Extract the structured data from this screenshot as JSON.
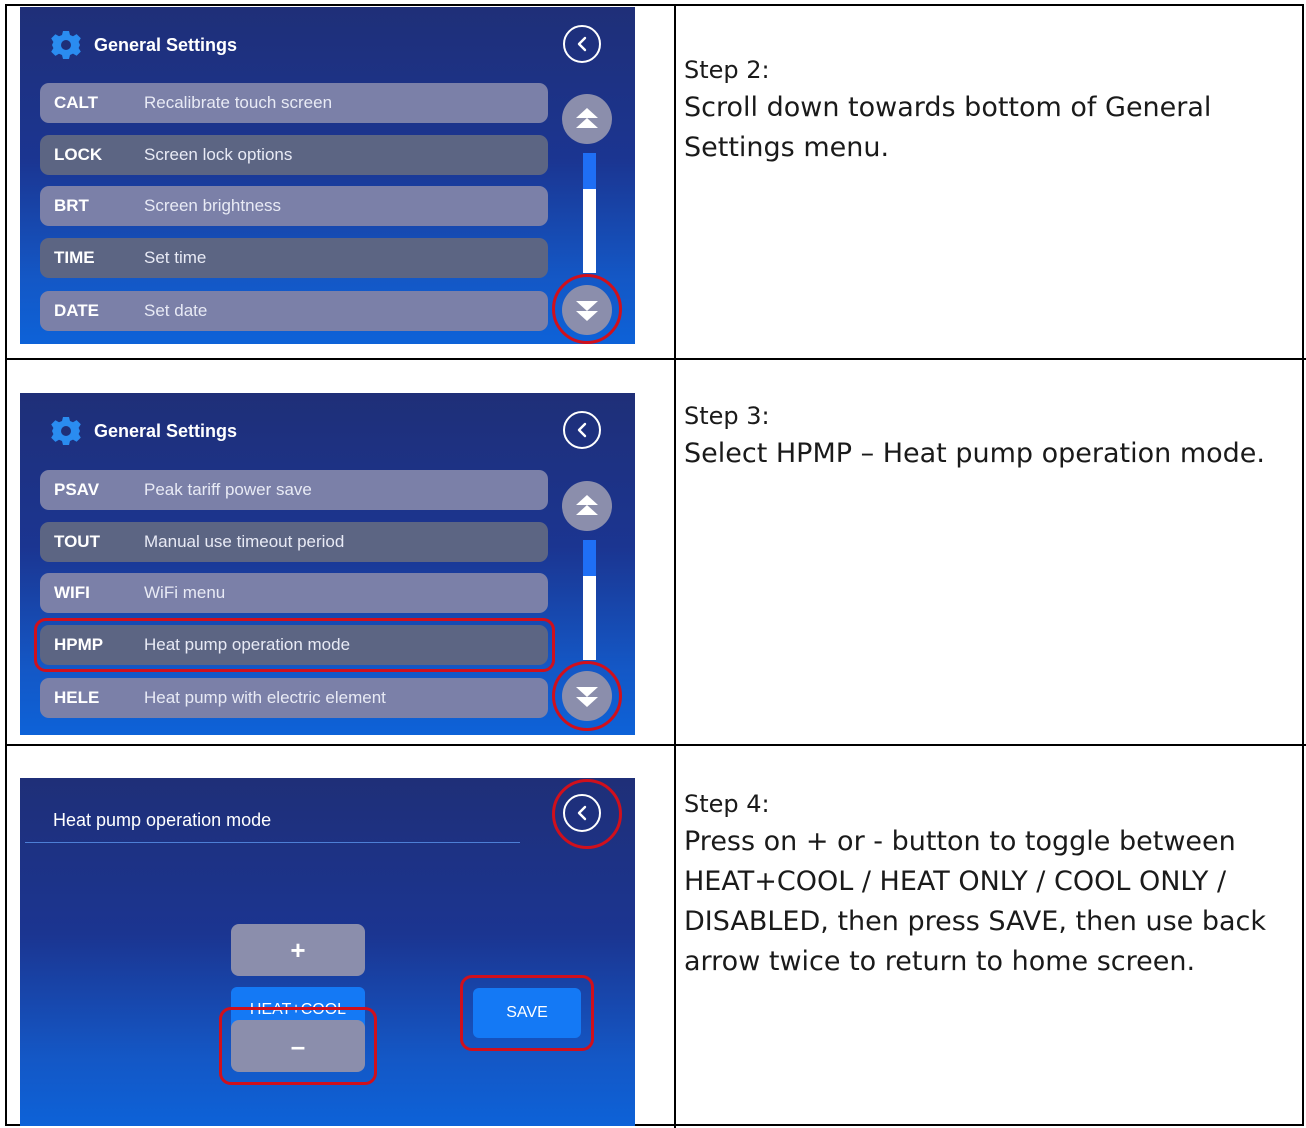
{
  "steps": [
    {
      "title": "Step 2:",
      "text": "Scroll down towards bottom of General Settings menu."
    },
    {
      "title": "Step 3:",
      "text": "Select HPMP – Heat pump operation mode."
    },
    {
      "title": "Step 4:",
      "text": "Press on + or - button to toggle between HEAT+COOL / HEAT ONLY / COOL ONLY / DISABLED, then press SAVE, then use back arrow twice to return to home screen."
    }
  ],
  "screen1": {
    "title": "General Settings",
    "items": [
      {
        "code": "CALT",
        "desc": "Recalibrate touch screen"
      },
      {
        "code": "LOCK",
        "desc": "Screen lock options"
      },
      {
        "code": "BRT",
        "desc": "Screen brightness"
      },
      {
        "code": "TIME",
        "desc": "Set time"
      },
      {
        "code": "DATE",
        "desc": "Set date"
      }
    ]
  },
  "screen2": {
    "title": "General Settings",
    "items": [
      {
        "code": "PSAV",
        "desc": "Peak tariff power save"
      },
      {
        "code": "TOUT",
        "desc": "Manual use timeout period"
      },
      {
        "code": "WIFI",
        "desc": "WiFi menu"
      },
      {
        "code": "HPMP",
        "desc": "Heat pump operation mode"
      },
      {
        "code": "HELE",
        "desc": "Heat pump with electric element"
      }
    ]
  },
  "screen3": {
    "title": "Heat pump operation mode",
    "plus_label": "+",
    "minus_label": "–",
    "mode_value": "HEAT+COOL",
    "save_label": "SAVE"
  },
  "colors": {
    "highlight": "#d0101c",
    "accent": "#1479f5",
    "row_light": "#7b80a8",
    "row_dark": "#5c6583"
  }
}
